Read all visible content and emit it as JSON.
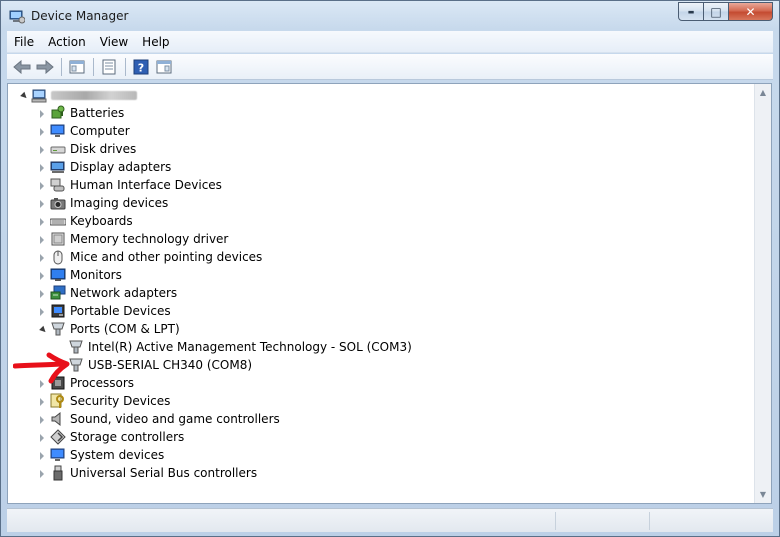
{
  "window": {
    "title": "Device Manager",
    "minimize_label": "▬",
    "maximize_label": "□",
    "close_label": "✕",
    "accent": "#c44b31"
  },
  "menu": [
    "File",
    "Action",
    "View",
    "Help"
  ],
  "toolbar": {
    "buttons": [
      "back-arrow-icon",
      "forward-arrow-icon",
      "console-tree-icon",
      "properties-icon",
      "help-icon",
      "action-pane-icon"
    ]
  },
  "tree": {
    "categories": [
      "Batteries",
      "Computer",
      "Disk drives",
      "Display adapters",
      "Human Interface Devices",
      "Imaging devices",
      "Keyboards",
      "Memory technology driver",
      "Mice and other pointing devices",
      "Monitors",
      "Network adapters",
      "Portable Devices",
      "Ports (COM & LPT)",
      "Intel(R) Active Management Technology - SOL (COM3)",
      "USB-SERIAL CH340 (COM8)",
      "Processors",
      "Security Devices",
      "Sound, video and game controllers",
      "Storage controllers",
      "System devices",
      "Universal Serial Bus controllers"
    ]
  },
  "annotation": {
    "color": "#e8101a"
  }
}
